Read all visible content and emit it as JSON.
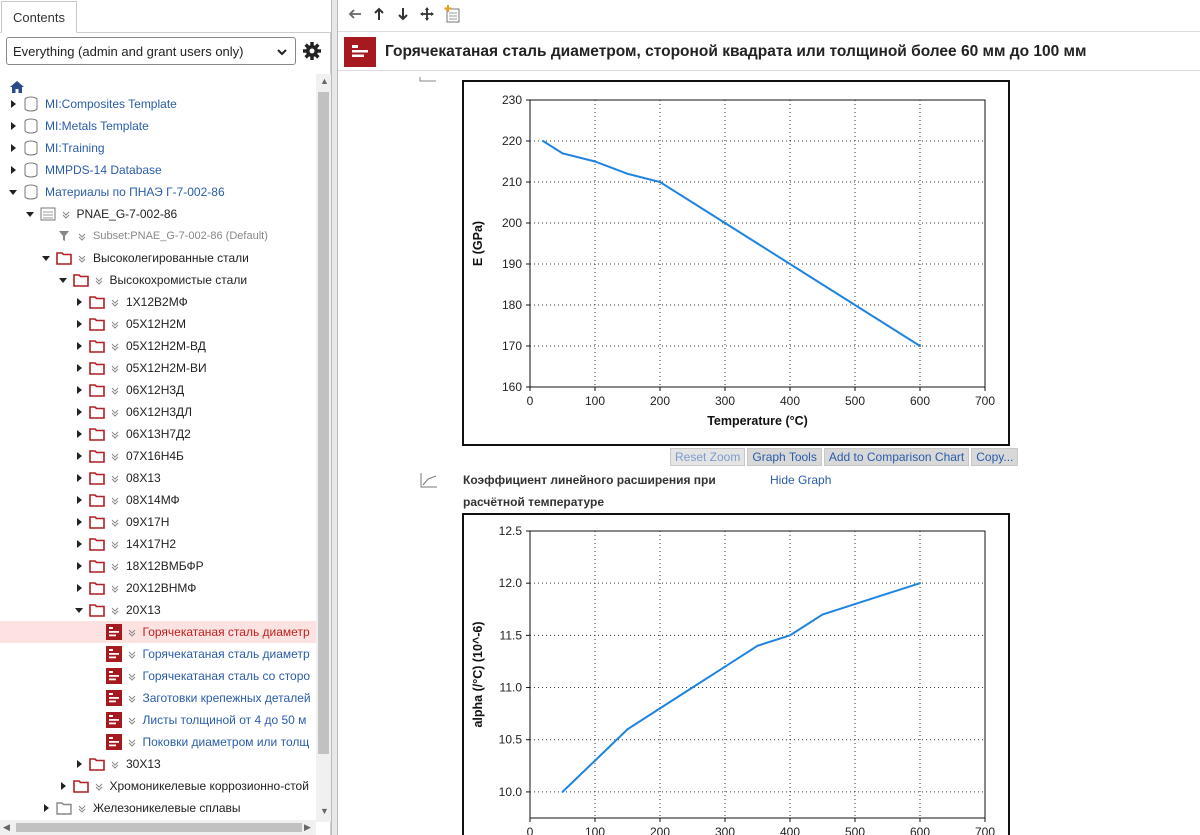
{
  "left_panel": {
    "tab_label": "Contents",
    "filter_value": "Everything (admin and grant users only)",
    "tree": [
      {
        "label": "MI:Composites Template",
        "depth": 0,
        "expanded": false,
        "icon": "database-icon",
        "style": "link"
      },
      {
        "label": "MI:Metals Template",
        "depth": 0,
        "expanded": false,
        "icon": "database-icon",
        "style": "link"
      },
      {
        "label": "MI:Training",
        "depth": 0,
        "expanded": false,
        "icon": "database-icon",
        "style": "link"
      },
      {
        "label": "MMPDS-14 Database",
        "depth": 0,
        "expanded": false,
        "icon": "database-icon",
        "style": "link"
      },
      {
        "label": "Материалы по ПНАЭ Г-7-002-86",
        "depth": 0,
        "expanded": true,
        "icon": "database-icon",
        "style": "link"
      },
      {
        "label": "PNAE_G-7-002-86",
        "depth": 1,
        "expanded": true,
        "icon": "table-icon",
        "style": "plain"
      },
      {
        "label": "Subset:PNAE_G-7-002-86 (Default)",
        "depth": 2,
        "expanded": null,
        "icon": "filter-icon",
        "style": "grey"
      },
      {
        "label": "Высоколегированные стали",
        "depth": 2,
        "expanded": true,
        "icon": "folder-icon",
        "style": "plain"
      },
      {
        "label": "Высокохромистые стали",
        "depth": 3,
        "expanded": true,
        "icon": "folder-icon",
        "style": "plain"
      },
      {
        "label": "1Х12В2МФ",
        "depth": 4,
        "expanded": false,
        "icon": "folder-icon",
        "style": "plain"
      },
      {
        "label": "05Х12Н2М",
        "depth": 4,
        "expanded": false,
        "icon": "folder-icon",
        "style": "plain"
      },
      {
        "label": "05Х12Н2М-ВД",
        "depth": 4,
        "expanded": false,
        "icon": "folder-icon",
        "style": "plain"
      },
      {
        "label": "05Х12Н2М-ВИ",
        "depth": 4,
        "expanded": false,
        "icon": "folder-icon",
        "style": "plain"
      },
      {
        "label": "06Х12Н3Д",
        "depth": 4,
        "expanded": false,
        "icon": "folder-icon",
        "style": "plain"
      },
      {
        "label": "06Х12Н3ДЛ",
        "depth": 4,
        "expanded": false,
        "icon": "folder-icon",
        "style": "plain"
      },
      {
        "label": "06Х13Н7Д2",
        "depth": 4,
        "expanded": false,
        "icon": "folder-icon",
        "style": "plain"
      },
      {
        "label": "07Х16Н4Б",
        "depth": 4,
        "expanded": false,
        "icon": "folder-icon",
        "style": "plain"
      },
      {
        "label": "08Х13",
        "depth": 4,
        "expanded": false,
        "icon": "folder-icon",
        "style": "plain"
      },
      {
        "label": "08Х14МФ",
        "depth": 4,
        "expanded": false,
        "icon": "folder-icon",
        "style": "plain"
      },
      {
        "label": "09Х17Н",
        "depth": 4,
        "expanded": false,
        "icon": "folder-icon",
        "style": "plain"
      },
      {
        "label": "14Х17Н2",
        "depth": 4,
        "expanded": false,
        "icon": "folder-icon",
        "style": "plain"
      },
      {
        "label": "18Х12ВМБФР",
        "depth": 4,
        "expanded": false,
        "icon": "folder-icon",
        "style": "plain"
      },
      {
        "label": "20Х12ВНМФ",
        "depth": 4,
        "expanded": false,
        "icon": "folder-icon",
        "style": "plain"
      },
      {
        "label": "20Х13",
        "depth": 4,
        "expanded": true,
        "icon": "folder-icon",
        "style": "plain"
      },
      {
        "label": "Горячекатаная сталь диаметр",
        "depth": 5,
        "expanded": null,
        "icon": "record-icon",
        "style": "selected"
      },
      {
        "label": "Горячекатаная сталь диаметр",
        "depth": 5,
        "expanded": null,
        "icon": "record-icon",
        "style": "link"
      },
      {
        "label": "Горячекатаная сталь со сторо",
        "depth": 5,
        "expanded": null,
        "icon": "record-icon",
        "style": "link"
      },
      {
        "label": "Заготовки крепежных деталей",
        "depth": 5,
        "expanded": null,
        "icon": "record-icon",
        "style": "link"
      },
      {
        "label": "Листы толщиной от 4 до 50 м",
        "depth": 5,
        "expanded": null,
        "icon": "record-icon",
        "style": "link"
      },
      {
        "label": "Поковки диаметром или толщ",
        "depth": 5,
        "expanded": null,
        "icon": "record-icon",
        "style": "link"
      },
      {
        "label": "30Х13",
        "depth": 4,
        "expanded": false,
        "icon": "folder-icon",
        "style": "plain"
      },
      {
        "label": "Хромоникелевые коррозионно-стой",
        "depth": 3,
        "expanded": false,
        "icon": "folder-icon",
        "style": "plain"
      },
      {
        "label": "Железоникелевые сплавы",
        "depth": 2,
        "expanded": false,
        "icon": "folder-grey-icon",
        "style": "plain"
      }
    ]
  },
  "main": {
    "page_title": "Горячекатаная сталь диаметром, стороной квадрата или толщиной более 60 мм до 100 мм",
    "chart_buttons": [
      "Reset Zoom",
      "Graph Tools",
      "Add to Comparison Chart",
      "Copy..."
    ],
    "section2": {
      "title_line1": "Коэффициент линейного расширения при",
      "title_line2": "расчётной температуре",
      "hide_graph": "Hide Graph"
    }
  },
  "chart_data": [
    {
      "type": "line",
      "xlabel": "Temperature (°C)",
      "ylabel": "E (GPa)",
      "xlim": [
        0,
        700
      ],
      "ylim": [
        160,
        230
      ],
      "xticks": [
        0,
        100,
        200,
        300,
        400,
        500,
        600,
        700
      ],
      "yticks": [
        160,
        170,
        180,
        190,
        200,
        210,
        220,
        230
      ],
      "grid": true,
      "color": "#1f84e0",
      "x": [
        20,
        50,
        100,
        150,
        200,
        250,
        300,
        350,
        400,
        450,
        500,
        550,
        600
      ],
      "y": [
        220,
        217,
        215,
        212,
        210,
        205,
        200,
        195,
        190,
        185,
        180,
        175,
        170
      ]
    },
    {
      "type": "line",
      "xlabel": "",
      "ylabel": "alpha (/°C) (10^-6)",
      "xlim": [
        0,
        700
      ],
      "ylim": [
        9.75,
        12.5
      ],
      "xticks": [
        0,
        100,
        200,
        300,
        400,
        500,
        600,
        700
      ],
      "yticks": [
        10.0,
        10.5,
        11.0,
        11.5,
        12.0,
        12.5
      ],
      "grid": true,
      "color": "#1f84e0",
      "x": [
        50,
        100,
        150,
        200,
        250,
        300,
        350,
        400,
        450,
        500,
        550,
        600
      ],
      "y": [
        10.0,
        10.3,
        10.6,
        10.8,
        11.0,
        11.2,
        11.4,
        11.5,
        11.7,
        11.8,
        11.9,
        12.0
      ]
    }
  ]
}
